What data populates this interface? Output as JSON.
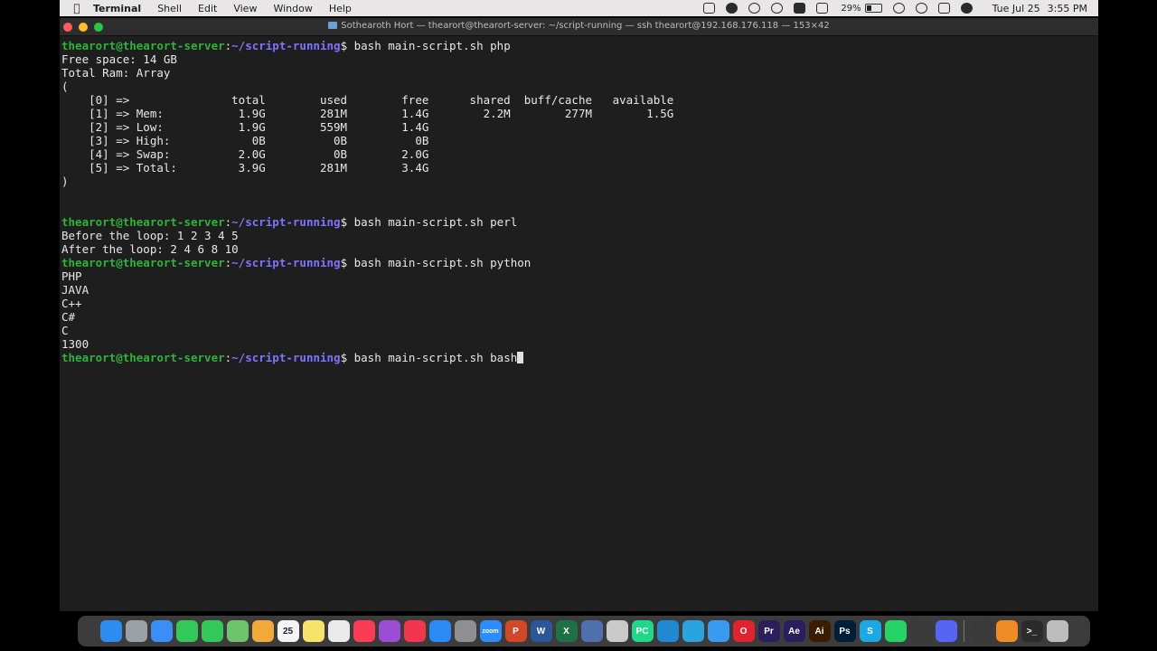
{
  "menubar": {
    "app_name": "Terminal",
    "menus": [
      "Shell",
      "Edit",
      "View",
      "Window",
      "Help"
    ],
    "battery_percent": "29%",
    "date": "Tue Jul 25",
    "time": "3:55 PM"
  },
  "window": {
    "title": "Sothearoth Hort — thearort@thearort-server: ~/script-running — ssh thearort@192.168.176.118 — 153×42"
  },
  "terminal": {
    "prompt_user": "thearort@thearort-server",
    "prompt_path": "~/script-running",
    "lines": [
      {
        "type": "prompt",
        "cmd": " bash main-script.sh php"
      },
      {
        "type": "out",
        "text": "Free space: 14 GB"
      },
      {
        "type": "out",
        "text": "Total Ram: Array"
      },
      {
        "type": "out",
        "text": "("
      },
      {
        "type": "out",
        "text": "    [0] =>               total        used        free      shared  buff/cache   available"
      },
      {
        "type": "out",
        "text": "    [1] => Mem:           1.9G        281M        1.4G        2.2M        277M        1.5G"
      },
      {
        "type": "out",
        "text": "    [2] => Low:           1.9G        559M        1.4G"
      },
      {
        "type": "out",
        "text": "    [3] => High:            0B          0B          0B"
      },
      {
        "type": "out",
        "text": "    [4] => Swap:          2.0G          0B        2.0G"
      },
      {
        "type": "out",
        "text": "    [5] => Total:         3.9G        281M        3.4G"
      },
      {
        "type": "out",
        "text": ")"
      },
      {
        "type": "out",
        "text": ""
      },
      {
        "type": "out",
        "text": ""
      },
      {
        "type": "prompt",
        "cmd": " bash main-script.sh perl"
      },
      {
        "type": "out",
        "text": "Before the loop: 1 2 3 4 5"
      },
      {
        "type": "out",
        "text": "After the loop: 2 4 6 8 10"
      },
      {
        "type": "prompt",
        "cmd": " bash main-script.sh python"
      },
      {
        "type": "out",
        "text": "PHP"
      },
      {
        "type": "out",
        "text": "JAVA"
      },
      {
        "type": "out",
        "text": "C++"
      },
      {
        "type": "out",
        "text": "C#"
      },
      {
        "type": "out",
        "text": "C"
      },
      {
        "type": "out",
        "text": "1300"
      },
      {
        "type": "prompt",
        "cmd": " bash main-script.sh bash",
        "cursor": true
      }
    ]
  },
  "dock": {
    "apps": [
      {
        "name": "finder-icon",
        "color": "#2d8cf0",
        "label": ""
      },
      {
        "name": "launchpad-icon",
        "color": "#9aa0a6",
        "label": ""
      },
      {
        "name": "mail-icon",
        "color": "#3a8ef6",
        "label": ""
      },
      {
        "name": "facetime-icon",
        "color": "#34c759",
        "label": ""
      },
      {
        "name": "messages-icon",
        "color": "#34c759",
        "label": ""
      },
      {
        "name": "maps-icon",
        "color": "#6fc36a",
        "label": ""
      },
      {
        "name": "photos-icon",
        "color": "#f2a93b",
        "label": ""
      },
      {
        "name": "calendar-icon",
        "color": "#f4f4f4",
        "label": "25"
      },
      {
        "name": "notes-icon",
        "color": "#f7e26b",
        "label": ""
      },
      {
        "name": "reminders-icon",
        "color": "#eaeaea",
        "label": ""
      },
      {
        "name": "music-icon",
        "color": "#fa3c55",
        "label": ""
      },
      {
        "name": "podcasts-icon",
        "color": "#9b4dd6",
        "label": ""
      },
      {
        "name": "news-icon",
        "color": "#f2364d",
        "label": ""
      },
      {
        "name": "app-store-icon",
        "color": "#2a8af6",
        "label": ""
      },
      {
        "name": "system-settings-icon",
        "color": "#8e8e93",
        "label": ""
      },
      {
        "name": "zoom-icon",
        "color": "#2d8cff",
        "label": "zoom"
      },
      {
        "name": "powerpoint-icon",
        "color": "#d24726",
        "label": "P"
      },
      {
        "name": "word-icon",
        "color": "#2b579a",
        "label": "W"
      },
      {
        "name": "excel-icon",
        "color": "#1e7145",
        "label": "X"
      },
      {
        "name": "virtualbox-icon",
        "color": "#4f6fae",
        "label": ""
      },
      {
        "name": "utility-icon",
        "color": "#c9c9c9",
        "label": ""
      },
      {
        "name": "pycharm-icon",
        "color": "#21d789",
        "label": "PC"
      },
      {
        "name": "vscode-icon",
        "color": "#1f8ad2",
        "label": ""
      },
      {
        "name": "telegram-icon",
        "color": "#2aa3df",
        "label": ""
      },
      {
        "name": "safari-icon",
        "color": "#3a9af0",
        "label": ""
      },
      {
        "name": "opera-icon",
        "color": "#e0242f",
        "label": "O"
      },
      {
        "name": "premiere-icon",
        "color": "#2a1e5c",
        "label": "Pr"
      },
      {
        "name": "after-effects-icon",
        "color": "#2a1e5c",
        "label": "Ae"
      },
      {
        "name": "illustrator-icon",
        "color": "#3a1c00",
        "label": "Ai"
      },
      {
        "name": "photoshop-icon",
        "color": "#001e36",
        "label": "Ps"
      },
      {
        "name": "skype-icon",
        "color": "#1ca8e3",
        "label": "S"
      },
      {
        "name": "whatsapp-icon",
        "color": "#25d366",
        "label": ""
      },
      {
        "name": "compass-icon",
        "color": "#3a3a3a",
        "label": ""
      },
      {
        "name": "discord-icon",
        "color": "#5865f2",
        "label": ""
      },
      {
        "name": "separator",
        "color": "",
        "label": ""
      },
      {
        "name": "screenshot-icon",
        "color": "#3a3a3a",
        "label": ""
      },
      {
        "name": "vlc-icon",
        "color": "#f08a24",
        "label": ""
      },
      {
        "name": "terminal-icon",
        "color": "#2b2b2b",
        "label": ">_"
      },
      {
        "name": "trash-icon",
        "color": "#bdbdbd",
        "label": ""
      }
    ]
  }
}
